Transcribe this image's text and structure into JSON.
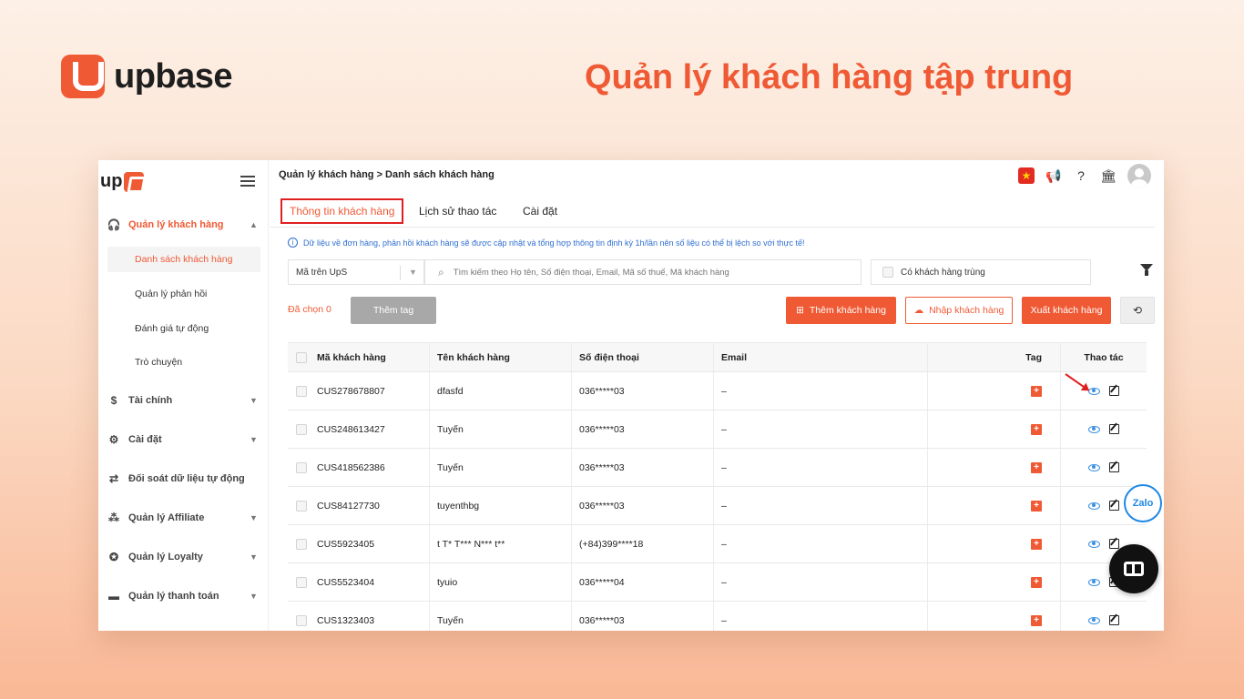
{
  "brand": {
    "name": "upbase",
    "headline": "Quản lý khách hàng tập trung"
  },
  "sidebar": {
    "logo_text": "up",
    "groups": [
      {
        "label": "Quản lý khách hàng",
        "icon": "headset-icon",
        "expanded": true,
        "items": [
          {
            "label": "Danh sách khách hàng",
            "active": true
          },
          {
            "label": "Quản lý phản hồi"
          },
          {
            "label": "Đánh giá tự động"
          },
          {
            "label": "Trò chuyện"
          }
        ]
      },
      {
        "label": "Tài chính",
        "icon": "dollar-icon"
      },
      {
        "label": "Cài đặt",
        "icon": "gear-icon"
      },
      {
        "label": "Đối soát dữ liệu tự động",
        "icon": "sync-icon"
      },
      {
        "label": "Quản lý Affiliate",
        "icon": "network-icon"
      },
      {
        "label": "Quản lý Loyalty",
        "icon": "award-icon"
      },
      {
        "label": "Quản lý thanh toán",
        "icon": "card-icon"
      }
    ]
  },
  "topbar": {
    "breadcrumb": "Quản lý khách hàng > Danh sách khách hàng",
    "flag_color": "#e32b22"
  },
  "tabs": [
    {
      "label": "Thông tin khách hàng",
      "active": true
    },
    {
      "label": "Lịch sử thao tác"
    },
    {
      "label": "Cài đặt"
    }
  ],
  "info_text": "Dữ liệu về đơn hàng, phản hồi khách hàng sẽ được cập nhật và tổng hợp thông tin định kỳ 1h/lần nên số liệu có thể bị lệch so với thực tế!",
  "filters": {
    "select_value": "Mã trên UpS",
    "search_placeholder": "Tìm kiếm theo Họ tên, Số điện thoại, Email, Mã số thuế, Mã khách hàng",
    "duplicate_label": "Có khách hàng trùng"
  },
  "actions": {
    "selected_label": "Đã chọn 0",
    "add_tag": "Thêm tag",
    "add_customer": "Thêm khách hàng",
    "import_customer": "Nhập khách hàng",
    "export_customer": "Xuất khách hàng"
  },
  "table": {
    "headers": {
      "code": "Mã khách hàng",
      "name": "Tên khách hàng",
      "phone": "Số điện thoại",
      "email": "Email",
      "tag": "Tag",
      "actions": "Thao tác"
    },
    "rows": [
      {
        "code": "CUS278678807",
        "name": "dfasfd",
        "phone": "036*****03",
        "email": "–"
      },
      {
        "code": "CUS248613427",
        "name": "Tuyến",
        "phone": "036*****03",
        "email": "–"
      },
      {
        "code": "CUS418562386",
        "name": "Tuyến",
        "phone": "036*****03",
        "email": "–"
      },
      {
        "code": "CUS84127730",
        "name": "tuyenthbg",
        "phone": "036*****03",
        "email": "–"
      },
      {
        "code": "CUS5923405",
        "name": "t T* T*** N*** t**",
        "phone": "(+84)399****18",
        "email": "–"
      },
      {
        "code": "CUS5523404",
        "name": "tyuio",
        "phone": "036*****04",
        "email": "–"
      },
      {
        "code": "CUS1323403",
        "name": "Tuyến",
        "phone": "036*****03",
        "email": "–"
      }
    ]
  },
  "widgets": {
    "zalo_label": "Zalo"
  },
  "colors": {
    "accent": "#ef5a35",
    "link": "#2f6fd1",
    "highlight_border": "#e02020"
  }
}
